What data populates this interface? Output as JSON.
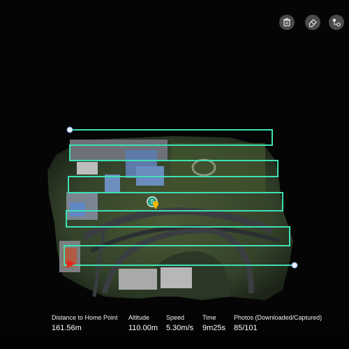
{
  "toolbar": {
    "delete_icon": "trash-icon",
    "erase_icon": "eraser-icon",
    "waypoints_icon": "waypoints-settings-icon"
  },
  "map": {
    "start_marker_label": "S",
    "route_color": "#3fe0b4",
    "aircraft_color": "#f5b400",
    "home_color": "#e0261d"
  },
  "stats": {
    "distance": {
      "label": "Distance to Home Point",
      "value": "161.56m"
    },
    "altitude": {
      "label": "Altitude",
      "value": "110.00m"
    },
    "speed": {
      "label": "Speed",
      "value": "5.30m/s"
    },
    "time": {
      "label": "Time",
      "value": "9m25s"
    },
    "photos": {
      "label": "Photos (Downloaded/Captured)",
      "value": "85/101"
    }
  }
}
